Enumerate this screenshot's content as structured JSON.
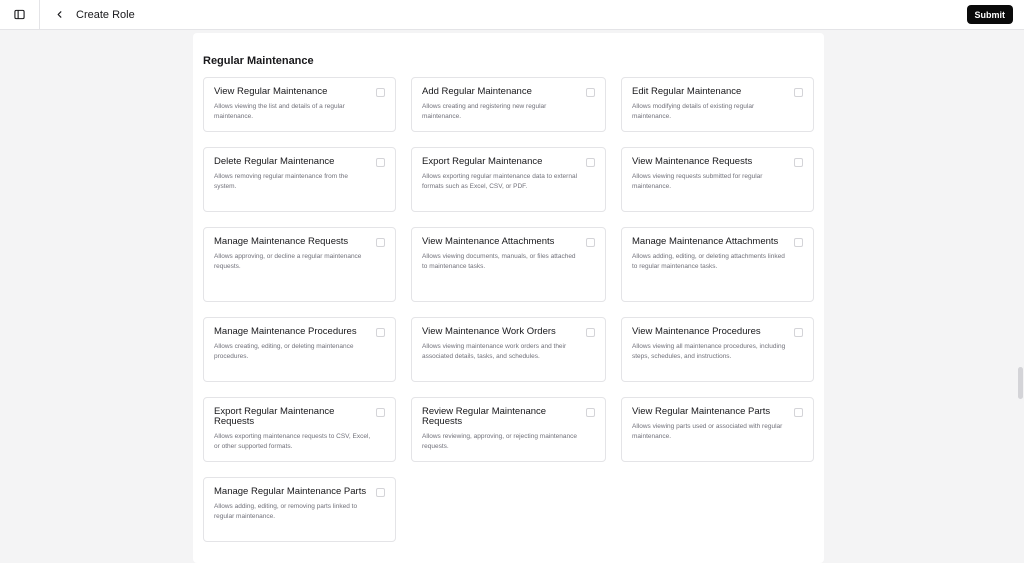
{
  "header": {
    "title": "Create Role",
    "submit_label": "Submit"
  },
  "icons": {
    "sidebar_toggle": "sidebar-toggle-icon",
    "back": "chevron-left-icon"
  },
  "section": {
    "title": "Regular Maintenance"
  },
  "permissions": [
    {
      "title": "View Regular Maintenance",
      "desc": "Allows viewing the list and details of a regular maintenance.",
      "checked": false
    },
    {
      "title": "Add Regular Maintenance",
      "desc": "Allows creating and registering new regular maintenance.",
      "checked": false
    },
    {
      "title": "Edit Regular Maintenance",
      "desc": "Allows modifying details of existing regular maintenance.",
      "checked": false
    },
    {
      "title": "Delete Regular Maintenance",
      "desc": "Allows removing regular maintenance from the system.",
      "checked": false
    },
    {
      "title": "Export Regular Maintenance",
      "desc": "Allows exporting regular maintenance data to external formats such as Excel, CSV, or PDF.",
      "checked": false
    },
    {
      "title": "View Maintenance Requests",
      "desc": "Allows viewing requests submitted for regular maintenance.",
      "checked": false
    },
    {
      "title": "Manage Maintenance Requests",
      "desc": "Allows approving, or decline a regular maintenance requests.",
      "checked": false
    },
    {
      "title": "View Maintenance Attachments",
      "desc": "Allows viewing documents, manuals, or files attached to maintenance tasks.",
      "checked": false
    },
    {
      "title": "Manage Maintenance Attachments",
      "desc": "Allows adding, editing, or deleting attachments linked to regular maintenance tasks.",
      "checked": false
    },
    {
      "title": "Manage Maintenance Procedures",
      "desc": "Allows creating, editing, or deleting maintenance procedures.",
      "checked": false
    },
    {
      "title": "View Maintenance Work Orders",
      "desc": "Allows viewing maintenance work orders and their associated details, tasks, and schedules.",
      "checked": false
    },
    {
      "title": "View Maintenance Procedures",
      "desc": "Allows viewing all maintenance procedures, including steps, schedules, and instructions.",
      "checked": false
    },
    {
      "title": "Export Regular Maintenance Requests",
      "desc": "Allows exporting maintenance requests to CSV, Excel, or other supported formats.",
      "checked": false
    },
    {
      "title": "Review Regular Maintenance Requests",
      "desc": "Allows reviewing, approving, or rejecting maintenance requests.",
      "checked": false
    },
    {
      "title": "View Regular Maintenance Parts",
      "desc": "Allows viewing parts used or associated with regular maintenance.",
      "checked": false
    },
    {
      "title": "Manage Regular Maintenance Parts",
      "desc": "Allows adding, editing, or removing parts linked to regular maintenance.",
      "checked": false
    }
  ]
}
